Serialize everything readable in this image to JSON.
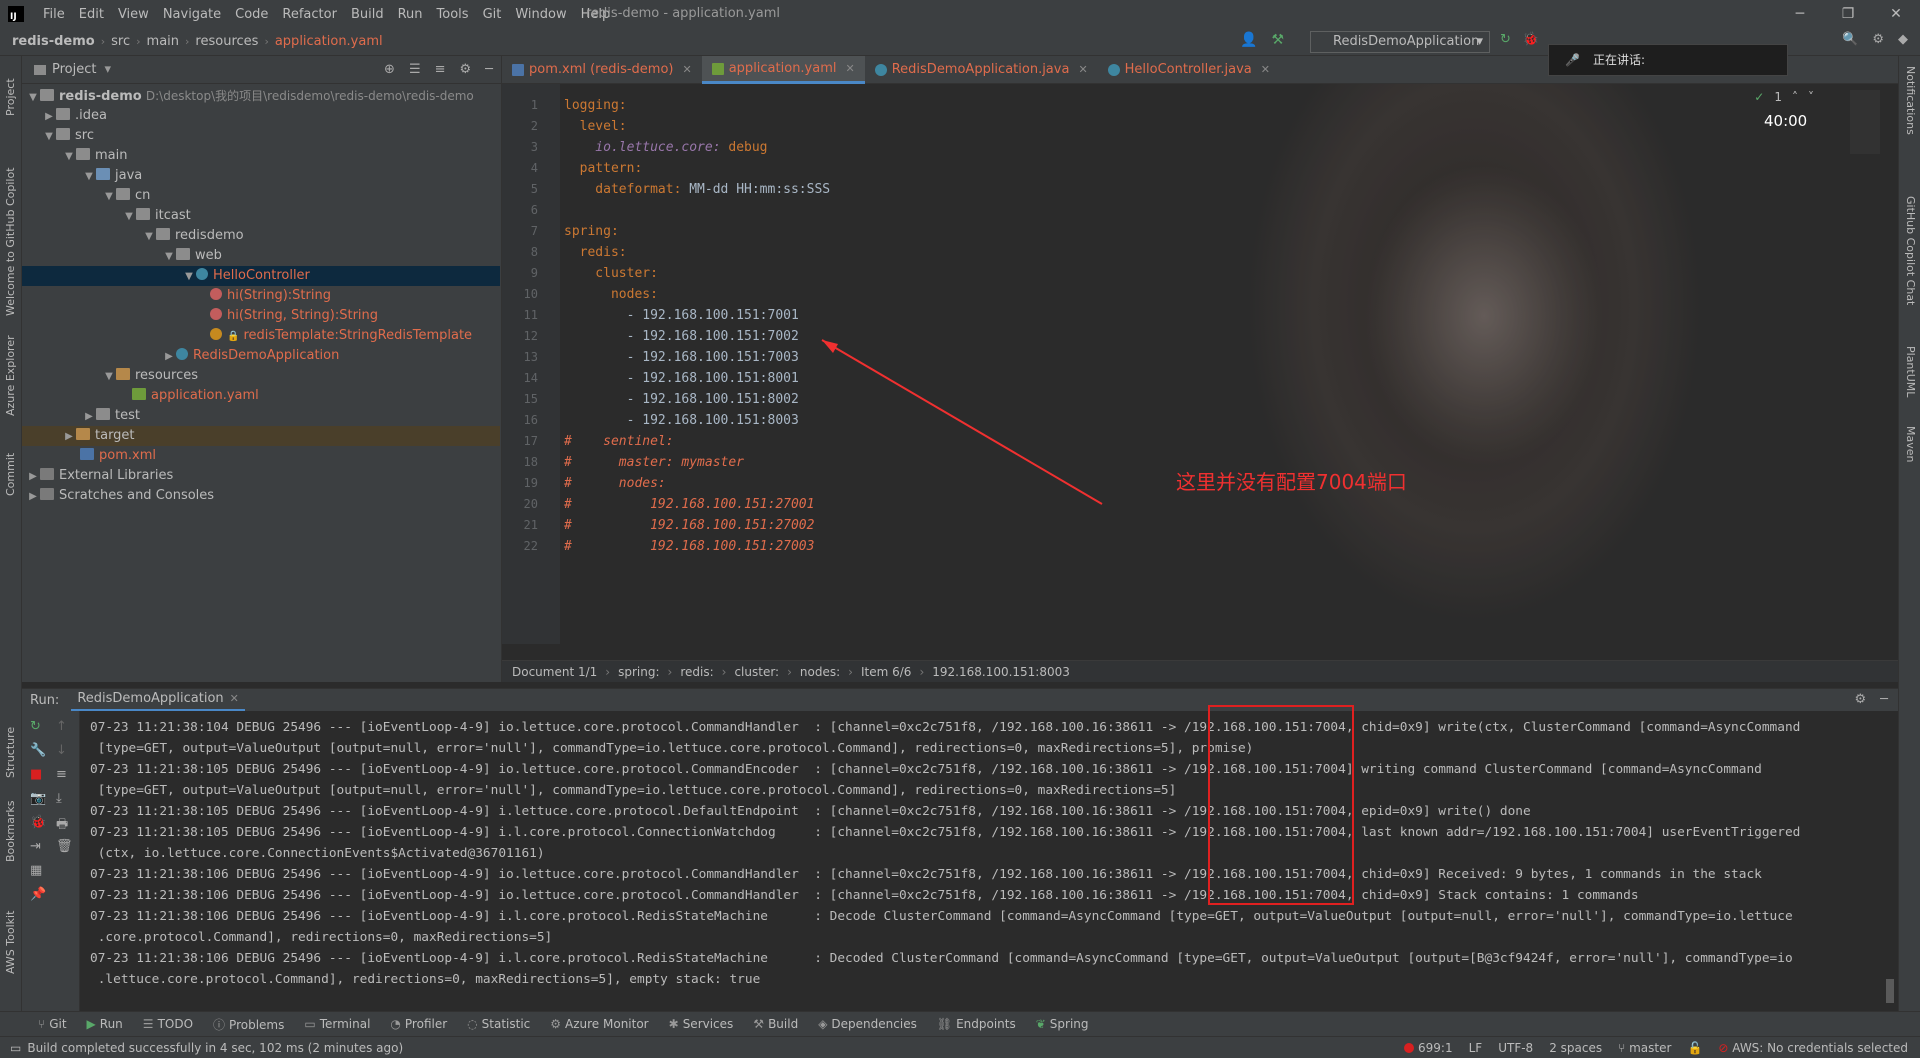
{
  "app": {
    "window_title": "redis-demo - application.yaml",
    "menu": [
      "File",
      "Edit",
      "View",
      "Navigate",
      "Code",
      "Refactor",
      "Build",
      "Run",
      "Tools",
      "Git",
      "Window",
      "Help"
    ]
  },
  "navbar": {
    "crumbs": [
      "redis-demo",
      "src",
      "main",
      "resources",
      "application.yaml"
    ],
    "run_config": "RedisDemoApplication"
  },
  "overlay": {
    "speaking": "正在讲话:",
    "timer": "40:00"
  },
  "left_strip": [
    "Project",
    "Welcome to GitHub Copilot",
    "Azure Explorer",
    "Commit",
    "Structure",
    "Bookmarks",
    "AWS Toolkit"
  ],
  "right_strip": [
    "Notifications",
    "GitHub Copilot Chat",
    "PlantUML",
    "Maven"
  ],
  "project": {
    "title": "Project",
    "tree": [
      {
        "label": "redis-demo",
        "extra": "D:\\desktop\\我的项目\\redisdemo\\redis-demo\\redis-demo"
      },
      {
        "label": ".idea"
      },
      {
        "label": "src"
      },
      {
        "label": "main"
      },
      {
        "label": "java"
      },
      {
        "label": "cn"
      },
      {
        "label": "itcast"
      },
      {
        "label": "redisdemo"
      },
      {
        "label": "web"
      },
      {
        "label": "HelloController"
      },
      {
        "label": "hi(String):String"
      },
      {
        "label": "hi(String, String):String"
      },
      {
        "label": "redisTemplate:StringRedisTemplate"
      },
      {
        "label": "RedisDemoApplication"
      },
      {
        "label": "resources"
      },
      {
        "label": "application.yaml"
      },
      {
        "label": "test"
      },
      {
        "label": "target"
      },
      {
        "label": "pom.xml"
      },
      {
        "label": "External Libraries"
      },
      {
        "label": "Scratches and Consoles"
      }
    ]
  },
  "editor": {
    "tabs": [
      {
        "label": "pom.xml (redis-demo)"
      },
      {
        "label": "application.yaml"
      },
      {
        "label": "RedisDemoApplication.java"
      },
      {
        "label": "HelloController.java"
      }
    ],
    "lines": [
      {
        "n": "1",
        "key": "logging:",
        "val": ""
      },
      {
        "n": "2",
        "key": "  level:",
        "val": ""
      },
      {
        "n": "3",
        "key": "    io.lettuce.core:",
        "val": " debug"
      },
      {
        "n": "4",
        "key": "  pattern:",
        "val": ""
      },
      {
        "n": "5",
        "key": "    dateformat:",
        "val": " MM-dd HH:mm:ss:SSS"
      },
      {
        "n": "6",
        "key": "",
        "val": ""
      },
      {
        "n": "7",
        "key": "spring:",
        "val": ""
      },
      {
        "n": "8",
        "key": "  redis:",
        "val": ""
      },
      {
        "n": "9",
        "key": "    cluster:",
        "val": ""
      },
      {
        "n": "10",
        "key": "      nodes:",
        "val": ""
      },
      {
        "n": "11",
        "key": "",
        "val": "        - 192.168.100.151:7001"
      },
      {
        "n": "12",
        "key": "",
        "val": "        - 192.168.100.151:7002"
      },
      {
        "n": "13",
        "key": "",
        "val": "        - 192.168.100.151:7003"
      },
      {
        "n": "14",
        "key": "",
        "val": "        - 192.168.100.151:8001"
      },
      {
        "n": "15",
        "key": "",
        "val": "        - 192.168.100.151:8002"
      },
      {
        "n": "16",
        "key": "",
        "val": "        - 192.168.100.151:8003"
      },
      {
        "n": "17",
        "key": "",
        "val": "#    sentinel:"
      },
      {
        "n": "18",
        "key": "",
        "val": "#      master: mymaster"
      },
      {
        "n": "19",
        "key": "",
        "val": "#      nodes:"
      },
      {
        "n": "20",
        "key": "",
        "val": "#          192.168.100.151:27001"
      },
      {
        "n": "21",
        "key": "",
        "val": "#          192.168.100.151:27002"
      },
      {
        "n": "22",
        "key": "",
        "val": "#          192.168.100.151:27003"
      }
    ],
    "annotation": "这里并没有配置7004端口",
    "inspection_count": "1",
    "breadcrumb": [
      "Document 1/1",
      "spring:",
      "redis:",
      "cluster:",
      "nodes:",
      "Item 6/6",
      "192.168.100.151:8003"
    ]
  },
  "run": {
    "label": "Run:",
    "tab": "RedisDemoApplication",
    "console": [
      "07-23 11:21:38:104 DEBUG 25496 --- [ioEventLoop-4-9] io.lettuce.core.protocol.CommandHandler  : [channel=0xc2c751f8, /192.168.100.16:38611 -> /192.168.100.151:7004, chid=0x9] write(ctx, ClusterCommand [command=AsyncCommand",
      " [type=GET, output=ValueOutput [output=null, error='null'], commandType=io.lettuce.core.protocol.Command], redirections=0, maxRedirections=5], promise)",
      "07-23 11:21:38:105 DEBUG 25496 --- [ioEventLoop-4-9] io.lettuce.core.protocol.CommandEncoder  : [channel=0xc2c751f8, /192.168.100.16:38611 -> /192.168.100.151:7004] writing command ClusterCommand [command=AsyncCommand",
      " [type=GET, output=ValueOutput [output=null, error='null'], commandType=io.lettuce.core.protocol.Command], redirections=0, maxRedirections=5]",
      "07-23 11:21:38:105 DEBUG 25496 --- [ioEventLoop-4-9] i.lettuce.core.protocol.DefaultEndpoint  : [channel=0xc2c751f8, /192.168.100.16:38611 -> /192.168.100.151:7004, epid=0x9] write() done",
      "07-23 11:21:38:105 DEBUG 25496 --- [ioEventLoop-4-9] i.l.core.protocol.ConnectionWatchdog     : [channel=0xc2c751f8, /192.168.100.16:38611 -> /192.168.100.151:7004, last known addr=/192.168.100.151:7004] userEventTriggered",
      " (ctx, io.lettuce.core.ConnectionEvents$Activated@36701161)",
      "07-23 11:21:38:106 DEBUG 25496 --- [ioEventLoop-4-9] io.lettuce.core.protocol.CommandHandler  : [channel=0xc2c751f8, /192.168.100.16:38611 -> /192.168.100.151:7004, chid=0x9] Received: 9 bytes, 1 commands in the stack",
      "07-23 11:21:38:106 DEBUG 25496 --- [ioEventLoop-4-9] io.lettuce.core.protocol.CommandHandler  : [channel=0xc2c751f8, /192.168.100.16:38611 -> /192.168.100.151:7004, chid=0x9] Stack contains: 1 commands",
      "07-23 11:21:38:106 DEBUG 25496 --- [ioEventLoop-4-9] i.l.core.protocol.RedisStateMachine      : Decode ClusterCommand [command=AsyncCommand [type=GET, output=ValueOutput [output=null, error='null'], commandType=io.lettuce",
      " .core.protocol.Command], redirections=0, maxRedirections=5]",
      "07-23 11:21:38:106 DEBUG 25496 --- [ioEventLoop-4-9] i.l.core.protocol.RedisStateMachine      : Decoded ClusterCommand [command=AsyncCommand [type=GET, output=ValueOutput [output=[B@3cf9424f, error='null'], commandType=io",
      " .lettuce.core.protocol.Command], redirections=0, maxRedirections=5], empty stack: true"
    ]
  },
  "bottom_tools": [
    "Git",
    "Run",
    "TODO",
    "Problems",
    "Terminal",
    "Profiler",
    "Statistic",
    "Azure Monitor",
    "Services",
    "Build",
    "Dependencies",
    "Endpoints",
    "Spring"
  ],
  "status": {
    "message": "Build completed successfully in 4 sec, 102 ms (2 minutes ago)",
    "position": "699:1",
    "line_sep": "LF",
    "encoding": "UTF-8",
    "indent": "2 spaces",
    "branch": "master",
    "aws": "AWS: No credentials selected"
  },
  "colors": {
    "accent": "#4a88c7",
    "modified_file": "#e06c4c",
    "annotation": "#f03030",
    "yaml_key": "#cc7832"
  }
}
